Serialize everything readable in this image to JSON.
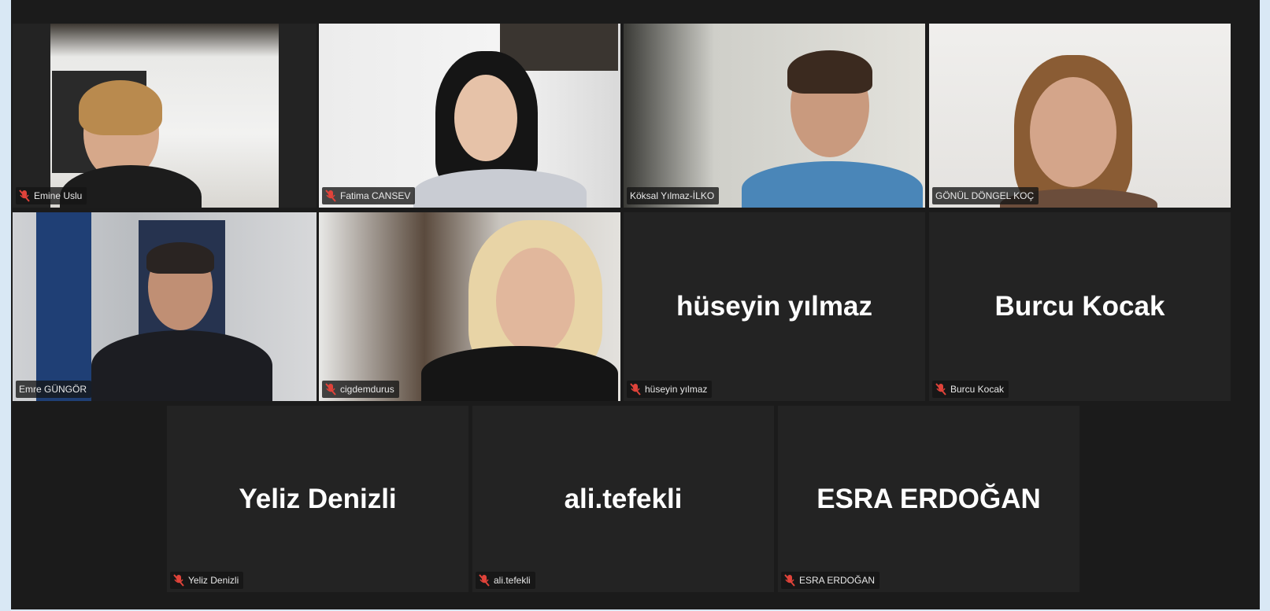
{
  "participants": [
    {
      "name": "Emine Uslu",
      "video": true
    },
    {
      "name": "Fatima CANSEV",
      "video": true
    },
    {
      "name": "Köksal Yılmaz-İLKO",
      "video": true
    },
    {
      "name": "GÖNÜL DÖNGEL KOÇ",
      "video": true
    },
    {
      "name": "Emre GÜNGÖR",
      "video": true,
      "active_speaker": true
    },
    {
      "name": "cigdemdurus",
      "video": true
    },
    {
      "name": "hüseyin yılmaz",
      "video": false
    },
    {
      "name": "Burcu Kocak",
      "video": false
    },
    {
      "name": "Yeliz Denizli",
      "video": false
    },
    {
      "name": "ali.tefekli",
      "video": false
    },
    {
      "name": "ESRA ERDOĞAN",
      "video": false
    }
  ],
  "colors": {
    "background": "#1b1b1b",
    "tile": "#232323",
    "active_border": "#c9e36a",
    "muted_mic": "#e0433a"
  },
  "icons": {
    "muted_mic": "muted-mic-icon"
  }
}
